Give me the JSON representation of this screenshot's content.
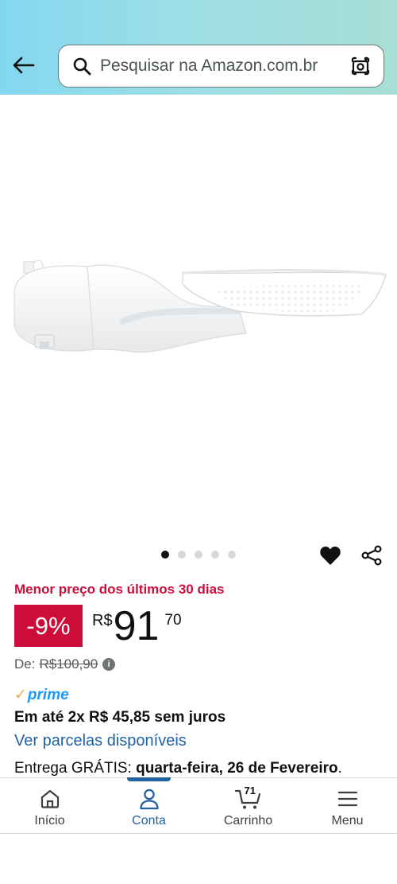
{
  "header": {
    "search_placeholder": "Pesquisar na Amazon.com.br"
  },
  "carousel": {
    "total_images": 5,
    "active_index": 0
  },
  "pricing": {
    "deal_label": "Menor preço dos últimos 30 dias",
    "discount": "-9%",
    "currency": "R$",
    "price_whole": "91",
    "price_fraction": "70",
    "list_price_label": "De:",
    "list_price": "R$100,90",
    "info_icon": "i"
  },
  "prime": {
    "check": "✓",
    "label": "prime"
  },
  "installments": {
    "text": "Em até 2x R$ 45,85 sem juros",
    "link": "Ver parcelas disponíveis"
  },
  "delivery": {
    "prefix": "Entrega GRÁTIS: ",
    "date": "quarta-feira, 26 de Fevereiro",
    "suffix": "."
  },
  "bottom_nav": {
    "items": [
      {
        "label": "Início",
        "icon": "home-icon"
      },
      {
        "label": "Conta",
        "icon": "account-icon",
        "active": true
      },
      {
        "label": "Carrinho",
        "icon": "cart-icon",
        "count": "71"
      },
      {
        "label": "Menu",
        "icon": "menu-icon"
      }
    ]
  },
  "colors": {
    "accent_red": "#cc0c39",
    "link_blue": "#2162a1",
    "prime_blue": "#1a98ff",
    "prime_orange": "#f3a847"
  }
}
